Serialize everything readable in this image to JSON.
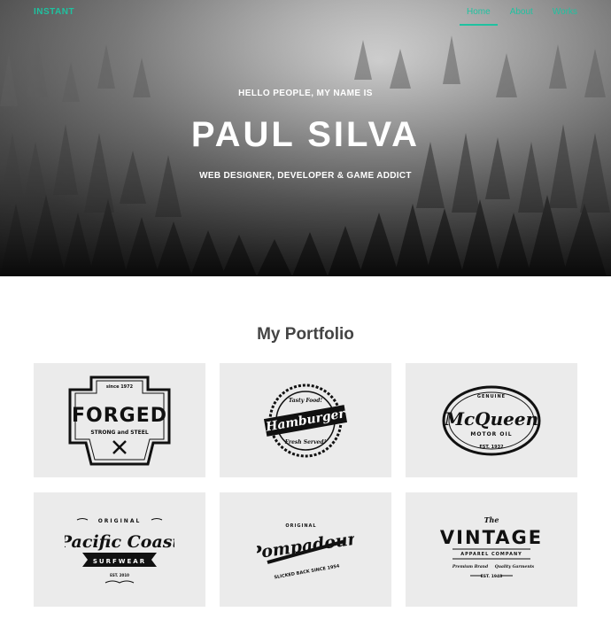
{
  "header": {
    "brand": "INSTANT",
    "nav": [
      {
        "label": "Home",
        "active": true
      },
      {
        "label": "About",
        "active": false
      },
      {
        "label": "Works",
        "active": false
      }
    ]
  },
  "hero": {
    "greeting": "HELLO PEOPLE, MY NAME IS",
    "name": "PAUL SILVA",
    "tagline": "WEB DESIGNER, DEVELOPER & GAME ADDICT"
  },
  "portfolio": {
    "title": "My Portfolio",
    "items": [
      {
        "logo": "FORGED",
        "sub": "STRONG and STEEL",
        "top": "since 1972"
      },
      {
        "logo": "Hamburger",
        "sub": "Fresh Served!",
        "top": "Tasty Food!"
      },
      {
        "logo": "McQueen",
        "sub": "MOTOR OIL",
        "top": "GENUINE",
        "bottom": "EST. 1932"
      },
      {
        "logo": "Pacific Coast",
        "sub": "SURFWEAR",
        "top": "ORIGINAL",
        "bottom": "EST. 2010"
      },
      {
        "logo": "Pompadour",
        "sub": "SLICKED BACK SINCE 1954",
        "top": "ORIGINAL"
      },
      {
        "logo": "VINTAGE",
        "sub": "APPAREL COMPANY",
        "top": "The",
        "left": "Premium Brand",
        "right": "Quality Garments",
        "bottom": "EST. 1948"
      }
    ]
  },
  "colors": {
    "accent": "#1fc2a0",
    "card_bg": "#ebebeb",
    "logo_ink": "#111111"
  }
}
